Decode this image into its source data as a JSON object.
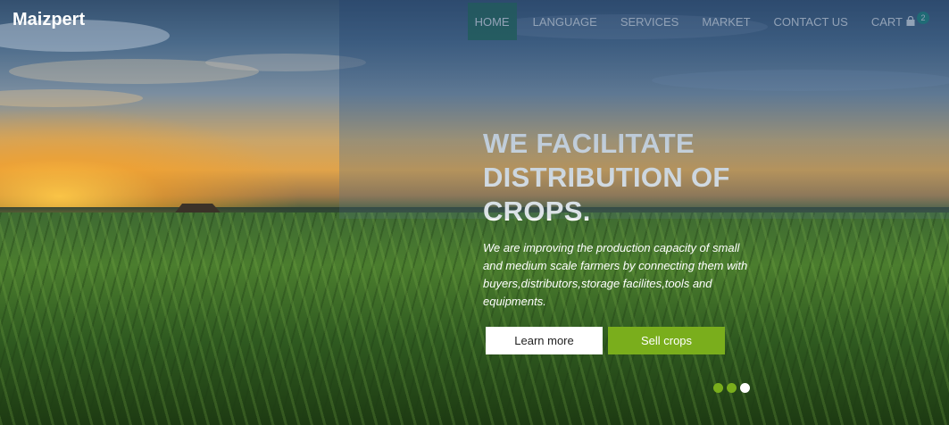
{
  "brand": {
    "name": "Maizpert"
  },
  "nav": {
    "items": [
      {
        "label": "HOME",
        "active": true
      },
      {
        "label": "LANGUAGE"
      },
      {
        "label": "SERVICES"
      },
      {
        "label": "MARKET"
      },
      {
        "label": "CONTACT US"
      }
    ],
    "cart": {
      "label": "CART",
      "count": "2",
      "icon": "shopping-bag-icon"
    }
  },
  "hero": {
    "headline": "WE FACILITATE DISTRIBUTION OF CROPS.",
    "subtext": "We are improving the production capacity of small and medium scale farmers by connecting them with buyers,distributors,storage facilites,tools and equipments.",
    "learn_more_label": "Learn more",
    "sell_crops_label": "Sell crops"
  },
  "carousel": {
    "slide_count": 3,
    "active_index": 2
  },
  "colors": {
    "accent_green": "#7aae1c",
    "active_nav": "#1e6b4f",
    "badge": "#14907a"
  }
}
